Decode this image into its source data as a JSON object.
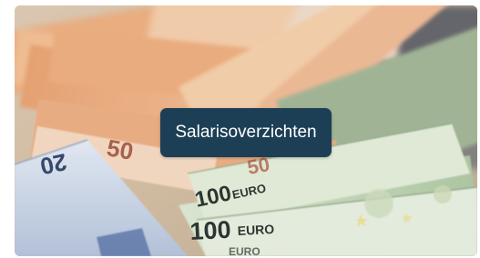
{
  "card": {
    "button_label": "Salarisoverzichten",
    "button_color": "#1c3f56"
  },
  "photo": {
    "note_texts": [
      "20",
      "50",
      "100",
      "EURO",
      "100",
      "EURO",
      "50",
      "EURO"
    ]
  }
}
